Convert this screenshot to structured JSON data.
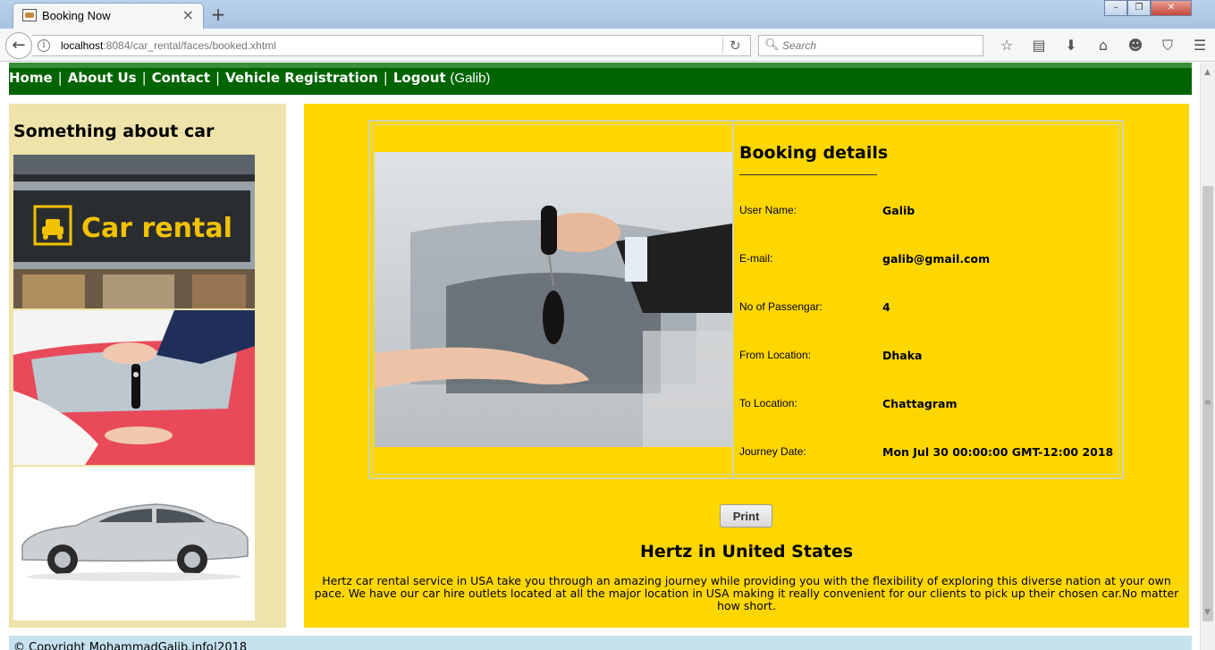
{
  "browser": {
    "tab_title": "Booking Now",
    "tab_close": "×",
    "new_tab": "+",
    "url_host": "localhost",
    "url_path": ":8084/car_rental/faces/booked.xhtml",
    "search_placeholder": "Search",
    "window_buttons": [
      "–",
      "❐",
      "✕"
    ],
    "toolbar_icons": [
      "star-icon",
      "reading-list-icon",
      "download-icon",
      "home-icon",
      "emoji-icon",
      "pocket-icon",
      "menu-icon"
    ]
  },
  "nav": {
    "home": "Home",
    "about": "About Us",
    "contact": "Contact",
    "vehicle_registration": "Vehicle Registration",
    "logout": "Logout",
    "user": "(Galib)",
    "separator": "|"
  },
  "sidebar": {
    "title": "Something about car",
    "sign_text": "Car rental"
  },
  "booking": {
    "title": "Booking details",
    "rows": [
      {
        "label": "User Name:",
        "value": "Galib"
      },
      {
        "label": "E-mail:",
        "value": "galib@gmail.com"
      },
      {
        "label": "No of Passengar:",
        "value": "4"
      },
      {
        "label": "From Location:",
        "value": "Dhaka"
      },
      {
        "label": "To Location:",
        "value": "Chattagram"
      },
      {
        "label": "Journey Date:",
        "value": "Mon Jul 30 00:00:00 GMT-12:00 2018"
      }
    ],
    "print_label": "Print"
  },
  "hertz": {
    "title": "Hertz in United States",
    "text": "Hertz car rental service in USA take you through an amazing journey while providing you with the flexibility of exploring this diverse nation at your own pace. We have our car hire outlets located at all the major location in USA making it really convenient for our clients to pick up their chosen car.No matter how short."
  },
  "footer": {
    "text": "© Copyright MohammadGalib.info|2018"
  },
  "colors": {
    "nav_bg": "#006400",
    "sidebar_bg": "#eee3aa",
    "main_bg": "#ffd700",
    "footer_bg": "#c6e2ef"
  }
}
